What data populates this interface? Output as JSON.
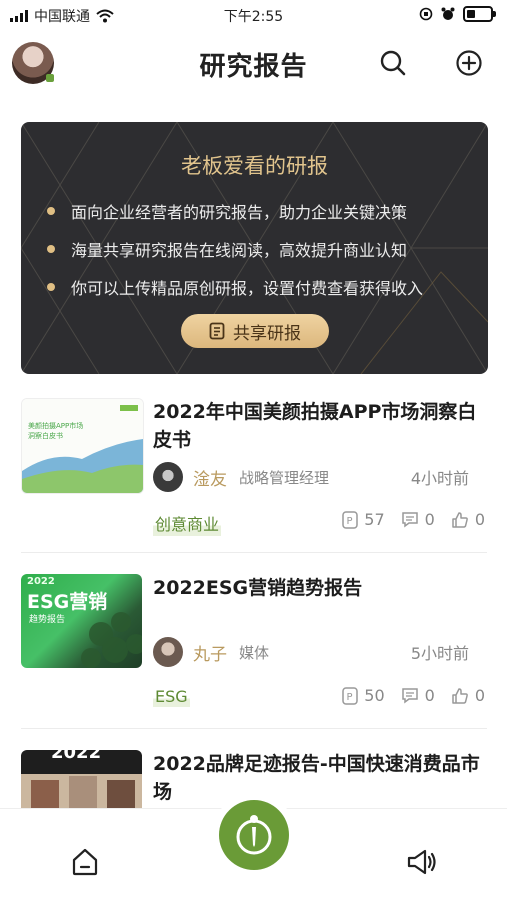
{
  "status_bar": {
    "carrier": "中国联通",
    "time": "下午2:55"
  },
  "header": {
    "title": "研究报告"
  },
  "banner": {
    "title": "老板爱看的研报",
    "bullets": [
      "面向企业经营者的研究报告，助力企业关键决策",
      "海量共享研究报告在线阅读，高效提升商业认知",
      "你可以上传精品原创研报，设置付费查看获得收入"
    ],
    "button_label": "共享研报",
    "accent_color": "#e0bf84"
  },
  "reports": [
    {
      "title": "2022年中国美颜拍摄APP市场洞察白皮书",
      "thumb_text": "美颜拍摄APP市场洞察白皮书",
      "author": "淦友",
      "role": "战略管理经理",
      "time": "4小时前",
      "tag": "创意商业",
      "points": "57",
      "comments": "0",
      "likes": "0"
    },
    {
      "title": "2022ESG营销趋势报告",
      "thumb_text": {
        "year": "2022",
        "big": "ESG营销",
        "sub": "趋势报告"
      },
      "author": "丸子",
      "role": "媒体",
      "time": "5小时前",
      "tag": "ESG",
      "points": "50",
      "comments": "0",
      "likes": "0"
    },
    {
      "title": "2022品牌足迹报告-中国快速消费品市场",
      "thumb_text": "2022"
    }
  ],
  "tabbar": {
    "brand_color": "#6a9b37"
  }
}
